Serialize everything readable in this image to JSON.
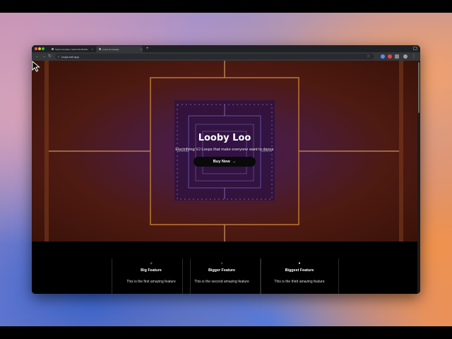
{
  "browser": {
    "tabs": [
      {
        "title": "Select template | SaaS Site Builder",
        "active": false
      },
      {
        "title": "Loops Homepage",
        "active": true
      }
    ],
    "new_tab_icon": "plus-icon",
    "url": "loops.sell.app",
    "nav_icons": [
      "back-arrow-icon",
      "forward-arrow-icon",
      "reload-icon"
    ]
  },
  "hero": {
    "title": "Looby Loo",
    "subtitle": "Electrifying VJ Loops that make everyone want to dance",
    "cta_label": "Buy Now",
    "cta_icon": "→"
  },
  "features": [
    {
      "icon": "♫",
      "title": "Big Feature",
      "description": "This is the first amazing feature"
    },
    {
      "icon": "♪",
      "title": "Bigger Feature",
      "description": "This is the second amazing feature"
    },
    {
      "icon": "●",
      "title": "Biggest Feature",
      "description": "This is the third amazing feature"
    }
  ],
  "colors": {
    "hero_background": "#4e1a12",
    "frame_line": "#c8813c",
    "button_bg": "#0a0a0a"
  }
}
